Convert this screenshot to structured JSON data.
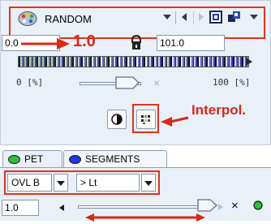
{
  "colormap": {
    "name": "RANDOM",
    "palette_icon": "palette-icon"
  },
  "toolbar": {
    "dropdown_icon": "chevron-down-icon",
    "left_icon": "triangle-left-icon",
    "right_icon": "triangle-right-icon",
    "color_square_icon": "color-square-icon",
    "color_cubes_icon": "color-cubes-icon",
    "overflow_icon": "chevron-down-icon"
  },
  "range": {
    "min_value": "0.0",
    "max_value": "101.0",
    "annotation_value": "1.0",
    "lock_icon": "lock-icon"
  },
  "scale": {
    "min_label": "0 [%]",
    "max_label": "100 [%]",
    "close_symbol": "×"
  },
  "buttons": {
    "invert_icon": "half-circle-icon",
    "interpolation_icon": "dot-grid-icon"
  },
  "annotations": {
    "interpolation": "Interpol.",
    "accent_color": "#d72818"
  },
  "tabs": [
    {
      "label": "PET",
      "dot_color": "#2fbf3b"
    },
    {
      "label": "SEGMENTS",
      "dot_color": "#1f36e0"
    }
  ],
  "segments": {
    "method": "OVL B",
    "operator": "> Lt",
    "value": "1.0",
    "close_symbol": "×"
  }
}
